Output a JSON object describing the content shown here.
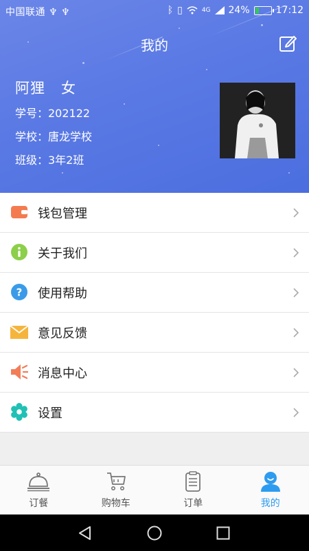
{
  "status_bar": {
    "carrier": "中国联通 ♆ ♆",
    "battery_percent": "24%",
    "battery_level": 0.24,
    "time": "17:12",
    "network": "4G"
  },
  "header": {
    "title": "我的"
  },
  "profile": {
    "name": "阿狸",
    "gender": "女",
    "student_id": "学号：202122",
    "school": "学校：唐龙学校",
    "class": "班级：3年2班"
  },
  "menu": [
    {
      "label": "钱包管理",
      "icon": "wallet-icon",
      "color": "#f47b50"
    },
    {
      "label": "关于我们",
      "icon": "info-icon",
      "color": "#8ccf4a"
    },
    {
      "label": "使用帮助",
      "icon": "help-icon",
      "color": "#3b9be8"
    },
    {
      "label": "意见反馈",
      "icon": "mail-icon",
      "color": "#f5b53d"
    },
    {
      "label": "消息中心",
      "icon": "speaker-icon",
      "color": "#f37d57"
    },
    {
      "label": "设置",
      "icon": "gear-icon",
      "color": "#21c0b5"
    }
  ],
  "tabs": [
    {
      "label": "订餐",
      "icon": "cloche-icon"
    },
    {
      "label": "购物车",
      "icon": "cart-icon"
    },
    {
      "label": "订单",
      "icon": "order-list-icon"
    },
    {
      "label": "我的",
      "icon": "user-icon",
      "active": true
    }
  ],
  "colors": {
    "header_gradient_start": "#6b86e8",
    "header_gradient_end": "#4b6edf",
    "active_tab": "#2d9cf0"
  }
}
